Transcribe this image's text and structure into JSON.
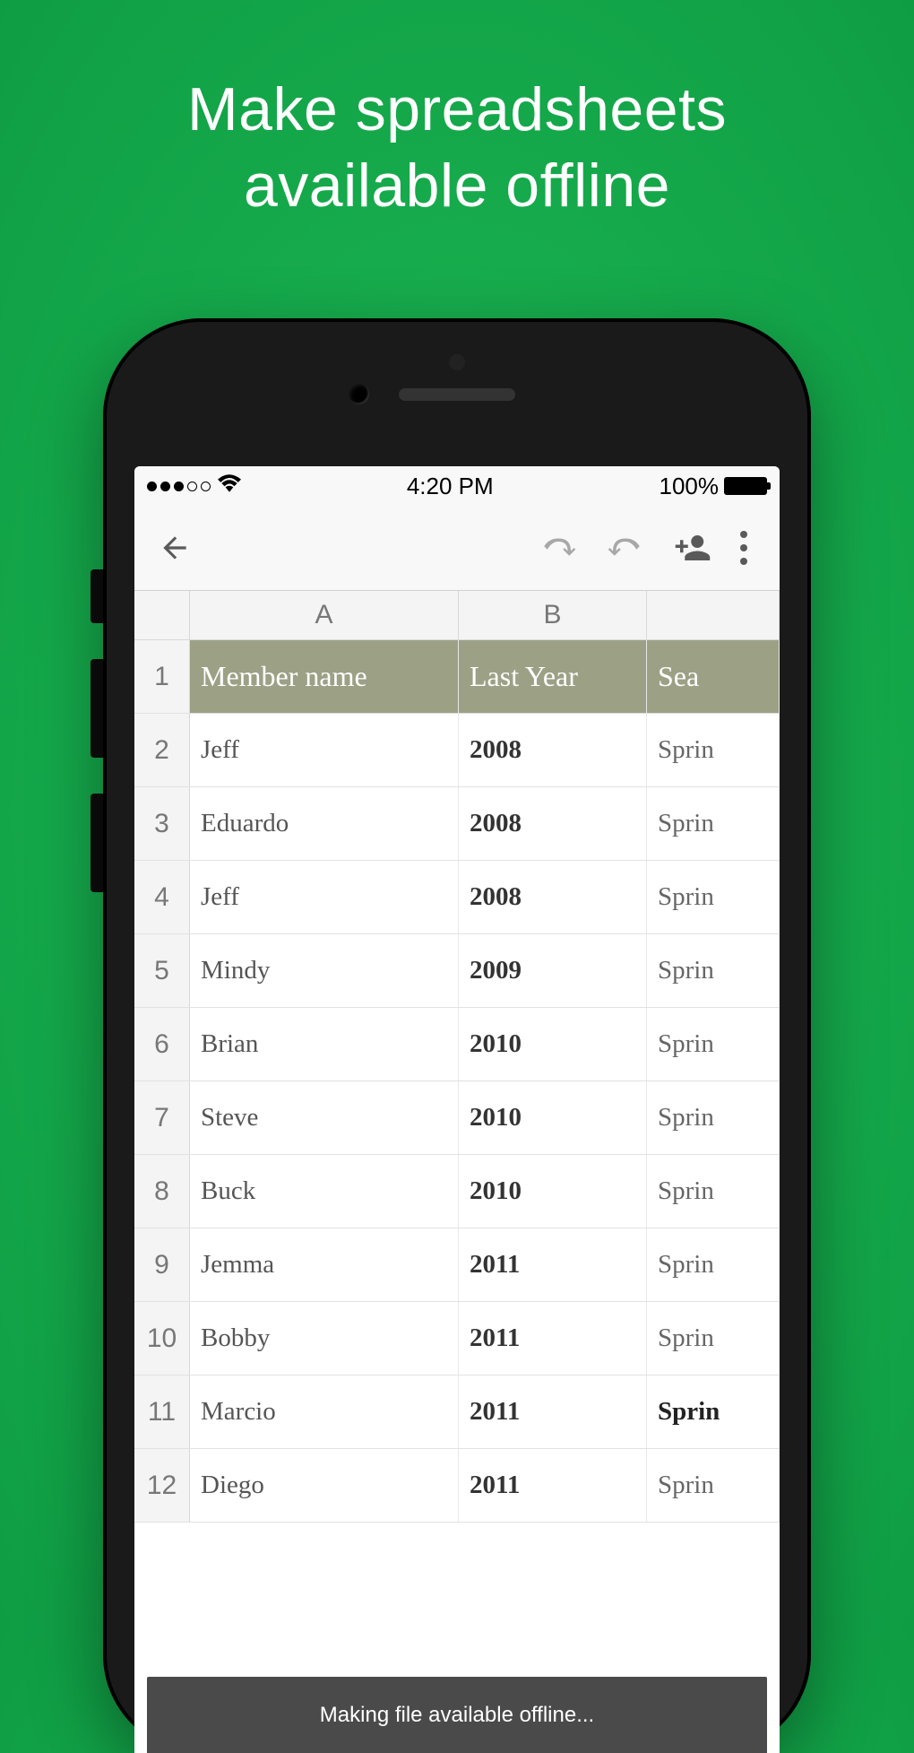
{
  "promo": {
    "title_line1": "Make spreadsheets",
    "title_line2": "available offline"
  },
  "status_bar": {
    "time": "4:20 PM",
    "battery_text": "100%"
  },
  "columns": {
    "A": "A",
    "B": "B"
  },
  "header_row": {
    "A": "Member name",
    "B": "Last Year",
    "C": "Sea"
  },
  "rows": [
    {
      "num": "1"
    },
    {
      "num": "2",
      "A": "Jeff",
      "B": "2008",
      "C": "Sprin"
    },
    {
      "num": "3",
      "A": "Eduardo",
      "B": "2008",
      "C": "Sprin"
    },
    {
      "num": "4",
      "A": "Jeff",
      "B": "2008",
      "C": "Sprin"
    },
    {
      "num": "5",
      "A": "Mindy",
      "B": "2009",
      "C": "Sprin"
    },
    {
      "num": "6",
      "A": "Brian",
      "B": "2010",
      "C": "Sprin"
    },
    {
      "num": "7",
      "A": "Steve",
      "B": "2010",
      "C": "Sprin"
    },
    {
      "num": "8",
      "A": "Buck",
      "B": "2010",
      "C": "Sprin"
    },
    {
      "num": "9",
      "A": "Jemma",
      "B": "2011",
      "C": "Sprin"
    },
    {
      "num": "10",
      "A": "Bobby",
      "B": "2011",
      "C": "Sprin"
    },
    {
      "num": "11",
      "A": "Marcio",
      "B": "2011",
      "C": "Sprin"
    },
    {
      "num": "12",
      "A": "Diego",
      "B": "2011",
      "C": "Sprin"
    }
  ],
  "toast": {
    "message": "Making file available offline..."
  }
}
